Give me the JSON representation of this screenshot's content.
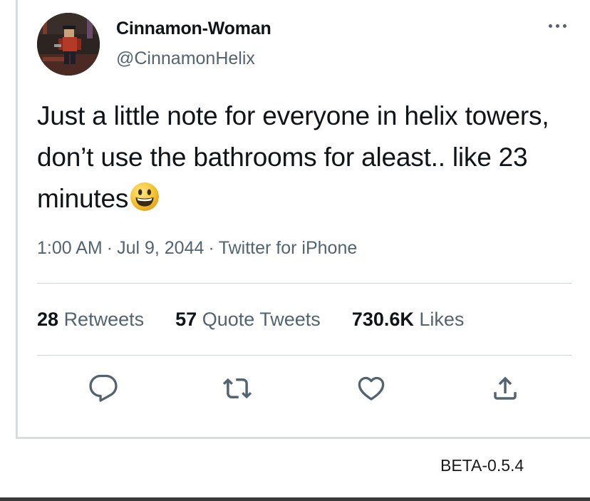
{
  "tweet": {
    "display_name": "Cinnamon-Woman",
    "handle": "@CinnamonHelix",
    "text": "Just a little note for everyone in helix towers, don’t use the bathrooms for aleast.. like 23 minutes",
    "time": "1:00 AM",
    "date": "Jul 9, 2044",
    "source": "Twitter for iPhone",
    "separator": "·"
  },
  "stats": {
    "retweets_count": "28",
    "retweets_label": "Retweets",
    "quotes_count": "57",
    "quotes_label": "Quote Tweets",
    "likes_count": "730.6K",
    "likes_label": "Likes"
  },
  "footer": {
    "version": "BETA-0.5.4"
  },
  "icons": {
    "reply": "reply-icon",
    "retweet": "retweet-icon",
    "like": "heart-icon",
    "share": "share-icon",
    "more": "more-icon",
    "emoji": "grinning-face-emoji"
  },
  "colors": {
    "text": "#0f1419",
    "secondary": "#536471",
    "divider": "#cfd9de",
    "emoji_yellow": "#f7c531"
  }
}
